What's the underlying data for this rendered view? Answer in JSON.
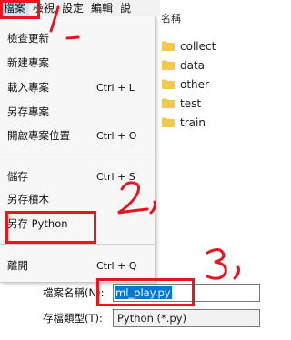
{
  "menubar": {
    "items": [
      {
        "label": "檔案",
        "active": true
      },
      {
        "label": "檢視"
      },
      {
        "label": "設定"
      },
      {
        "label": "編輯"
      },
      {
        "label": "說"
      }
    ]
  },
  "file_menu": {
    "items": [
      {
        "label": "檢查更新",
        "shortcut": ""
      },
      {
        "label": "新建專案",
        "shortcut": ""
      },
      {
        "label": "載入專案",
        "shortcut": "Ctrl + L"
      },
      {
        "label": "另存專案",
        "shortcut": ""
      },
      {
        "label": "開啟專案位置",
        "shortcut": "Ctrl + O"
      },
      {
        "label": "儲存",
        "shortcut": "Ctrl + S"
      },
      {
        "label": "另存積木",
        "shortcut": ""
      },
      {
        "label": "另存 Python",
        "shortcut": ""
      },
      {
        "label": "離開",
        "shortcut": "Ctrl + Q"
      }
    ]
  },
  "file_browser": {
    "column_header": "名稱",
    "folders": [
      "collect",
      "data",
      "other",
      "test",
      "train"
    ],
    "folder_color": "#f2c94c"
  },
  "save_form": {
    "filename_label": "檔案名稱(N):",
    "filename_value": "ml_play.py",
    "filetype_label": "存檔類型(T):",
    "filetype_value": "Python (*.py)"
  },
  "annotations": {
    "step_color": "#e8141f",
    "steps": [
      "1",
      "2",
      "3"
    ]
  }
}
